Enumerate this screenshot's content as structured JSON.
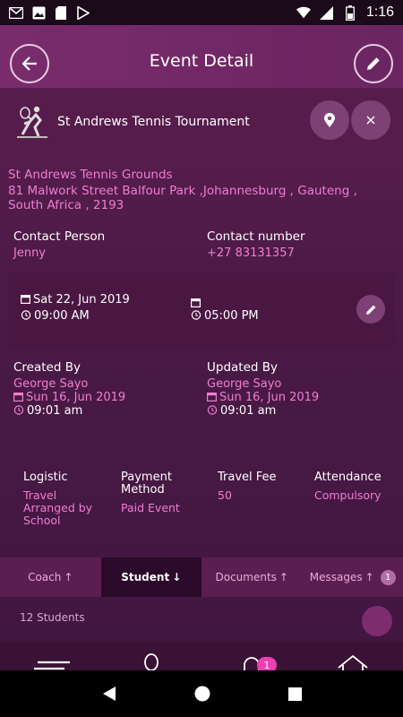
{
  "status_bar": {
    "time": "1:16",
    "icons": [
      "gmail-icon",
      "photo-icon",
      "sd-card-icon",
      "play-store-icon",
      "wifi-icon",
      "signal-icon",
      "battery-icon"
    ]
  },
  "header": {
    "title": "Event Detail"
  },
  "event": {
    "name": "St Andrews Tennis Tournament"
  },
  "venue": {
    "name": "St Andrews Tennis Grounds",
    "address": "81 Malwork Street Balfour Park ,Johannesburg , Gauteng , South Africa , 2193"
  },
  "contact": {
    "person_label": "Contact Person",
    "person_value": "Jenny",
    "number_label": "Contact number",
    "number_value": "+27 83131357"
  },
  "schedule": {
    "start_date": "Sat 22, Jun 2019",
    "start_time": "09:00 AM",
    "end_time": "05:00 PM"
  },
  "created": {
    "label": "Created By",
    "name": "George Sayo",
    "date": "Sun 16, Jun 2019",
    "time": "09:01 am"
  },
  "updated": {
    "label": "Updated By",
    "name": "George Sayo",
    "date": "Sun 16, Jun 2019",
    "time": "09:01 am"
  },
  "details": [
    {
      "label": "Logistic",
      "value": "Travel Arranged by School"
    },
    {
      "label": "Payment Method",
      "value": "Paid Event"
    },
    {
      "label": "Travel Fee",
      "value": "50"
    },
    {
      "label": "Attendance",
      "value": "Compulsory"
    }
  ],
  "tabs": [
    {
      "label": "Coach",
      "arrow": "↑",
      "badge": ""
    },
    {
      "label": "Student",
      "arrow": "↓",
      "badge": ""
    },
    {
      "label": "Documents",
      "arrow": "↑",
      "badge": ""
    },
    {
      "label": "Messages",
      "arrow": "↑",
      "badge": "1"
    }
  ],
  "students_peek": "12 Students",
  "bottom_nav": {
    "notification_count": "1"
  },
  "colors": {
    "accent": "#f07ed0",
    "header": "#7a2c6d",
    "badge": "#ec3fb2"
  }
}
